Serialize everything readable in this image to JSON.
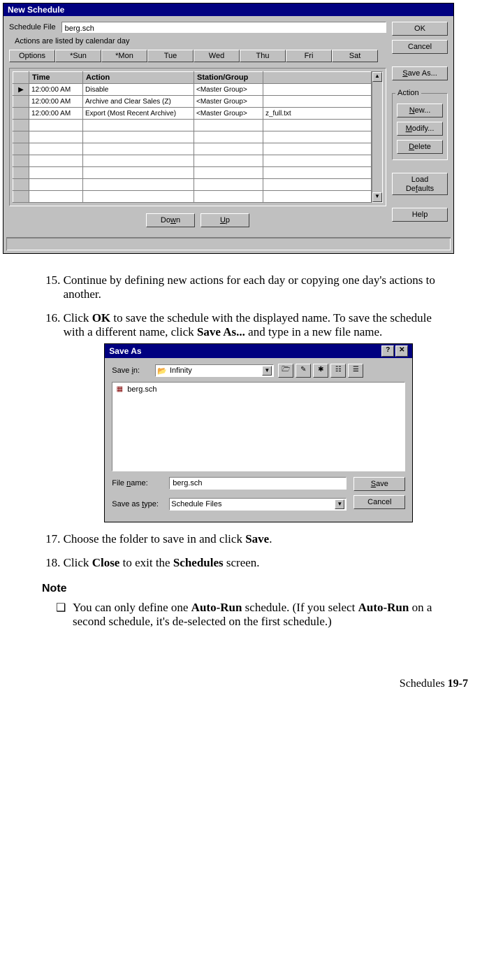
{
  "newSchedule": {
    "title": "New Schedule",
    "scheduleFileLabel": "Schedule File",
    "scheduleFileValue": "berg.sch",
    "hint": "Actions are listed by calendar day",
    "tabs": [
      "Options",
      "*Sun",
      "*Mon",
      "Tue",
      "Wed",
      "Thu",
      "Fri",
      "Sat"
    ],
    "columns": {
      "time": "Time",
      "action": "Action",
      "station": "Station/Group"
    },
    "rows": [
      {
        "marker": "▶",
        "time": "12:00:00 AM",
        "action": "Disable",
        "station": "<Master Group>",
        "extra": ""
      },
      {
        "marker": "",
        "time": "12:00:00 AM",
        "action": "Archive and Clear Sales (Z)",
        "station": "<Master Group>",
        "extra": ""
      },
      {
        "marker": "",
        "time": "12:00:00 AM",
        "action": "Export (Most Recent Archive)",
        "station": "<Master Group>",
        "extra": "z_full.txt"
      }
    ],
    "down": "Down",
    "up": "Up",
    "buttons": {
      "ok": "OK",
      "cancel": "Cancel",
      "saveAs": "Save As...",
      "actionGroup": "Action",
      "new": "New...",
      "modify": "Modify...",
      "delete": "Delete",
      "loadDefaults": "Load Defaults",
      "help": "Help"
    }
  },
  "steps": {
    "s15": "Continue by defining new actions for each day or copying one day's actions to another.",
    "s16_a": "Click ",
    "s16_b": "OK",
    "s16_c": " to save the schedule with the displayed name. To save the schedule with a different name, click ",
    "s16_d": "Save As...",
    "s16_e": " and type in  a new file name.",
    "s17_a": "Choose the folder to save in and click ",
    "s17_b": "Save",
    "s17_c": ".",
    "s18_a": "Click ",
    "s18_b": "Close",
    "s18_c": " to exit the ",
    "s18_d": "Schedules",
    "s18_e": " screen."
  },
  "saveAs": {
    "title": "Save As",
    "saveInLabel": "Save in:",
    "folder": "Infinity",
    "listed": "berg.sch",
    "fileNameLabel": "File name:",
    "fileNameValue": "berg.sch",
    "typeLabel": "Save as type:",
    "typeValue": "Schedule Files",
    "save": "Save",
    "cancel": "Cancel"
  },
  "note": {
    "heading": "Note",
    "n1_a": "You can only define one ",
    "n1_b": "Auto-Run",
    "n1_c": " schedule. (If you select ",
    "n1_d": "Auto-Run",
    "n1_e": " on a second schedule, it's de-selected on the first schedule.)"
  },
  "footer": {
    "label": "Schedules  ",
    "page": "19-7"
  }
}
